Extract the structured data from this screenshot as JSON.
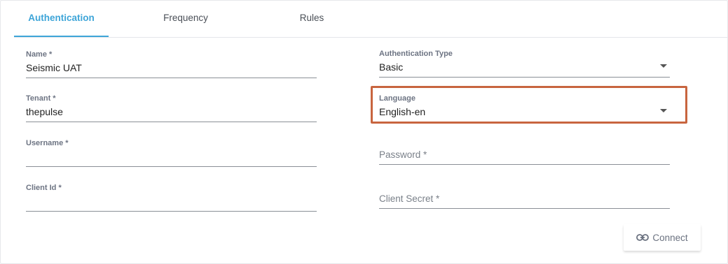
{
  "tabs": [
    {
      "label": "Authentication",
      "active": true
    },
    {
      "label": "Frequency",
      "active": false
    },
    {
      "label": "Rules",
      "active": false
    }
  ],
  "form": {
    "name": {
      "label": "Name *",
      "value": "Seismic UAT"
    },
    "tenant": {
      "label": "Tenant *",
      "value": "thepulse"
    },
    "username": {
      "label": "Username *",
      "value": ""
    },
    "client_id": {
      "label": "Client Id *",
      "value": ""
    },
    "auth_type": {
      "label": "Authentication Type",
      "value": "Basic"
    },
    "language": {
      "label": "Language",
      "value": "English-en"
    },
    "password": {
      "placeholder": "Password *"
    },
    "client_secret": {
      "placeholder": "Client Secret *"
    }
  },
  "connect_button": {
    "label": "Connect",
    "icon": "link-icon"
  },
  "colors": {
    "accent": "#3ea5d8",
    "highlight": "#c8653f"
  }
}
